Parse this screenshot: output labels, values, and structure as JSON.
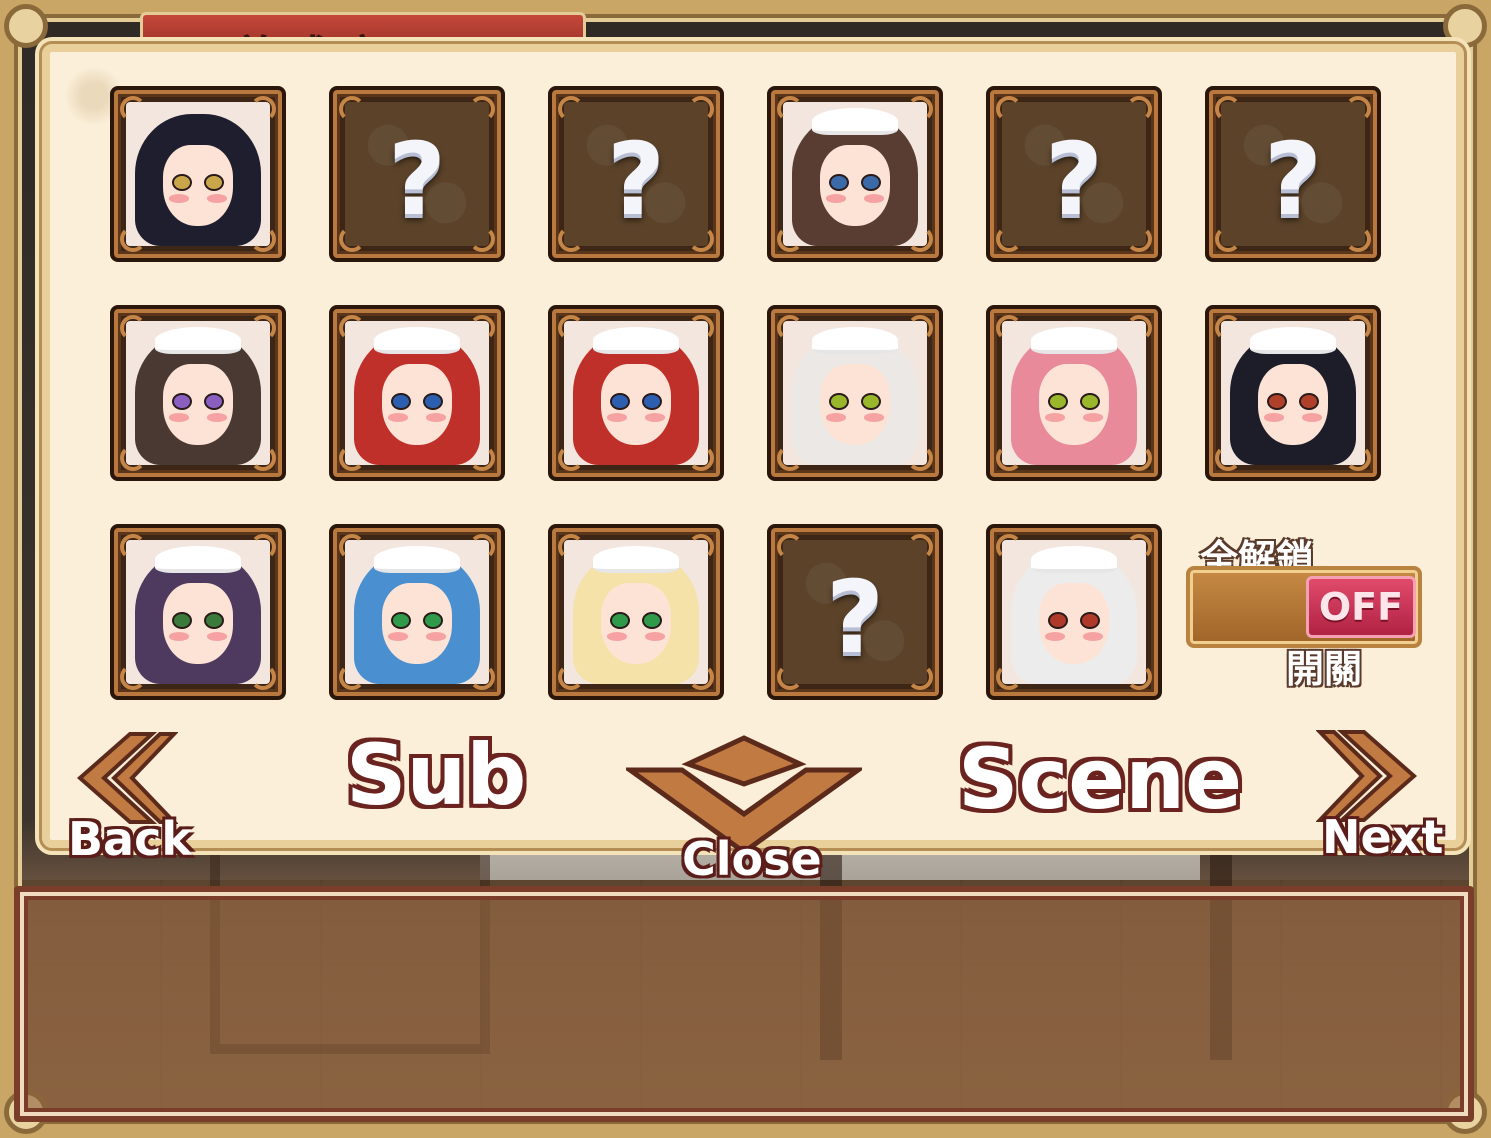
{
  "title": "養成室",
  "gallery": {
    "tiles": [
      {
        "state": "unlocked",
        "hair": "#1e1e2e",
        "eyes": "#c9a64a",
        "cap": false
      },
      {
        "state": "locked",
        "text": "?"
      },
      {
        "state": "locked",
        "text": "?"
      },
      {
        "state": "unlocked",
        "hair": "#5a3d32",
        "eyes": "#3b6aa8",
        "cap": true
      },
      {
        "state": "locked",
        "text": "?"
      },
      {
        "state": "locked",
        "text": "?"
      },
      {
        "state": "unlocked",
        "hair": "#4a3833",
        "eyes": "#8a5fc0",
        "cap": true
      },
      {
        "state": "unlocked",
        "hair": "#c0302a",
        "eyes": "#2c5fb0",
        "cap": true
      },
      {
        "state": "unlocked",
        "hair": "#c0302a",
        "eyes": "#2c5fb0",
        "cap": true
      },
      {
        "state": "unlocked",
        "hair": "#ece8e6",
        "eyes": "#9ab62a",
        "cap": true
      },
      {
        "state": "unlocked",
        "hair": "#e98a9a",
        "eyes": "#9ab62a",
        "cap": true
      },
      {
        "state": "unlocked",
        "hair": "#1d1d2a",
        "eyes": "#b0402a",
        "cap": true
      },
      {
        "state": "unlocked",
        "hair": "#4e3a5e",
        "eyes": "#3a7a3a",
        "cap": true
      },
      {
        "state": "unlocked",
        "hair": "#4a8fd0",
        "eyes": "#2e9a4a",
        "cap": true
      },
      {
        "state": "unlocked",
        "hair": "#f4e2a8",
        "eyes": "#2e9a4a",
        "cap": true
      },
      {
        "state": "locked",
        "text": "?"
      },
      {
        "state": "unlocked",
        "hair": "#ececec",
        "eyes": "#b03a2a",
        "cap": true
      }
    ]
  },
  "unlock_all": {
    "label": "全解鎖",
    "state": "OFF",
    "sub_label": "開關"
  },
  "nav": {
    "back": "Back",
    "sub": "Sub",
    "close": "Close",
    "scene": "Scene",
    "next": "Next"
  },
  "message_box": "",
  "colors": {
    "panel": "#fbefd9",
    "frame": "#c9a566",
    "tile_border": "#b9793e",
    "toggle_off": "#d0345a",
    "accent_dark": "#6b2320"
  }
}
